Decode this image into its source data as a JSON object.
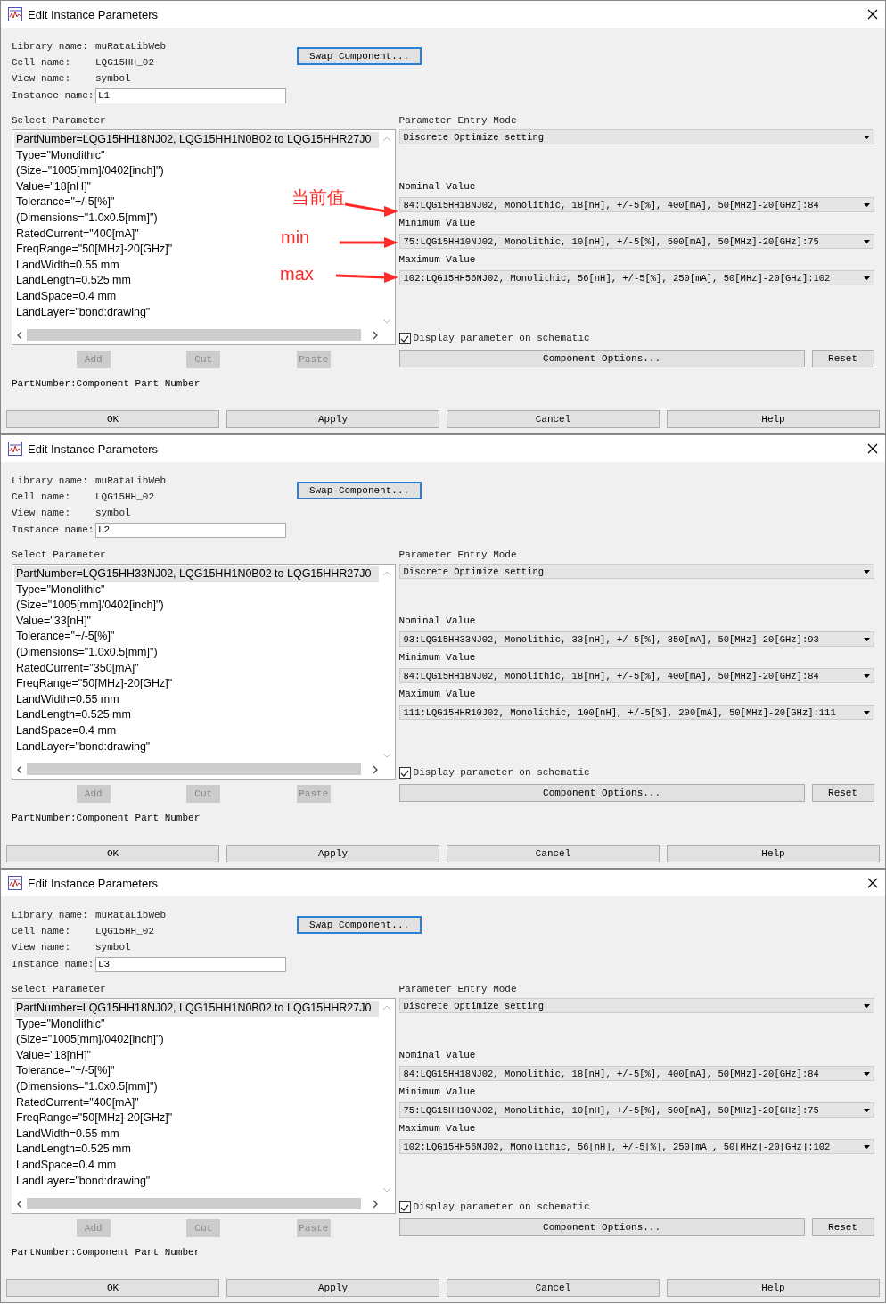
{
  "dialogs": [
    {
      "title": "Edit Instance Parameters",
      "info": [
        {
          "label": "Library name:",
          "value": "muRataLibWeb",
          "kind": "text"
        },
        {
          "label": "Cell name:",
          "value": "LQG15HH_02",
          "kind": "text"
        },
        {
          "label": "View name:",
          "value": "symbol",
          "kind": "text"
        },
        {
          "label": "Instance name:",
          "value": "L1",
          "kind": "input"
        }
      ],
      "swap_button": "Swap Component...",
      "select_parameter": {
        "label": "Select Parameter",
        "items": [
          {
            "text": "PartNumber=LQG15HH18NJ02, LQG15HH1N0B02 to LQG15HHR27J0",
            "selected": true
          },
          {
            "text": "Type=\"Monolithic\"",
            "selected": false
          },
          {
            "text": "(Size=\"1005[mm]/0402[inch]\")",
            "selected": false
          },
          {
            "text": "Value=\"18[nH]\"",
            "selected": false
          },
          {
            "text": "Tolerance=\"+/-5[%]\"",
            "selected": false
          },
          {
            "text": "(Dimensions=\"1.0x0.5[mm]\")",
            "selected": false
          },
          {
            "text": "RatedCurrent=\"400[mA]\"",
            "selected": false
          },
          {
            "text": "FreqRange=\"50[MHz]-20[GHz]\"",
            "selected": false
          },
          {
            "text": "LandWidth=0.55 mm",
            "selected": false
          },
          {
            "text": "LandLength=0.525 mm",
            "selected": false
          },
          {
            "text": "LandSpace=0.4 mm",
            "selected": false
          },
          {
            "text": "LandLayer=\"bond:drawing\"",
            "selected": false
          }
        ]
      },
      "edit_buttons": [
        {
          "label": "Add",
          "disabled": true
        },
        {
          "label": "Cut",
          "disabled": true
        },
        {
          "label": "Paste",
          "disabled": true
        }
      ],
      "description": "PartNumber:Component Part Number",
      "entry_mode": {
        "label": "Parameter Entry Mode",
        "value": "Discrete Optimize setting"
      },
      "value_fields": [
        {
          "label": "Nominal Value",
          "value": "84:LQG15HH18NJ02, Monolithic, 18[nH], +/-5[%], 400[mA], 50[MHz]-20[GHz]:84"
        },
        {
          "label": "Minimum Value",
          "value": "75:LQG15HH10NJ02, Monolithic, 10[nH], +/-5[%], 500[mA], 50[MHz]-20[GHz]:75"
        },
        {
          "label": "Maximum Value",
          "value": "102:LQG15HH56NJ02, Monolithic, 56[nH], +/-5[%], 250[mA], 50[MHz]-20[GHz]:102"
        }
      ],
      "display_checkbox": {
        "label": "Display parameter on schematic",
        "checked": true
      },
      "component_options": "Component Options...",
      "reset": "Reset",
      "footer_buttons": [
        "OK",
        "Apply",
        "Cancel",
        "Help"
      ],
      "annotations": [
        {
          "text": "当前值"
        },
        {
          "text": "min"
        },
        {
          "text": "max"
        }
      ]
    },
    {
      "title": "Edit Instance Parameters",
      "info": [
        {
          "label": "Library name:",
          "value": "muRataLibWeb",
          "kind": "text"
        },
        {
          "label": "Cell name:",
          "value": "LQG15HH_02",
          "kind": "text"
        },
        {
          "label": "View name:",
          "value": "symbol",
          "kind": "text"
        },
        {
          "label": "Instance name:",
          "value": "L2",
          "kind": "input"
        }
      ],
      "swap_button": "Swap Component...",
      "select_parameter": {
        "label": "Select Parameter",
        "items": [
          {
            "text": "PartNumber=LQG15HH33NJ02, LQG15HH1N0B02 to LQG15HHR27J0",
            "selected": true
          },
          {
            "text": "Type=\"Monolithic\"",
            "selected": false
          },
          {
            "text": "(Size=\"1005[mm]/0402[inch]\")",
            "selected": false
          },
          {
            "text": "Value=\"33[nH]\"",
            "selected": false
          },
          {
            "text": "Tolerance=\"+/-5[%]\"",
            "selected": false
          },
          {
            "text": "(Dimensions=\"1.0x0.5[mm]\")",
            "selected": false
          },
          {
            "text": "RatedCurrent=\"350[mA]\"",
            "selected": false
          },
          {
            "text": "FreqRange=\"50[MHz]-20[GHz]\"",
            "selected": false
          },
          {
            "text": "LandWidth=0.55 mm",
            "selected": false
          },
          {
            "text": "LandLength=0.525 mm",
            "selected": false
          },
          {
            "text": "LandSpace=0.4 mm",
            "selected": false
          },
          {
            "text": "LandLayer=\"bond:drawing\"",
            "selected": false
          }
        ]
      },
      "edit_buttons": [
        {
          "label": "Add",
          "disabled": true
        },
        {
          "label": "Cut",
          "disabled": true
        },
        {
          "label": "Paste",
          "disabled": true
        }
      ],
      "description": "PartNumber:Component Part Number",
      "entry_mode": {
        "label": "Parameter Entry Mode",
        "value": "Discrete Optimize setting"
      },
      "value_fields": [
        {
          "label": "Nominal Value",
          "value": "93:LQG15HH33NJ02, Monolithic, 33[nH], +/-5[%], 350[mA], 50[MHz]-20[GHz]:93"
        },
        {
          "label": "Minimum Value",
          "value": "84:LQG15HH18NJ02, Monolithic, 18[nH], +/-5[%], 400[mA], 50[MHz]-20[GHz]:84"
        },
        {
          "label": "Maximum Value",
          "value": "111:LQG15HHR10J02, Monolithic, 100[nH], +/-5[%], 200[mA], 50[MHz]-20[GHz]:111"
        }
      ],
      "display_checkbox": {
        "label": "Display parameter on schematic",
        "checked": true
      },
      "component_options": "Component Options...",
      "reset": "Reset",
      "footer_buttons": [
        "OK",
        "Apply",
        "Cancel",
        "Help"
      ]
    },
    {
      "title": "Edit Instance Parameters",
      "info": [
        {
          "label": "Library name:",
          "value": "muRataLibWeb",
          "kind": "text"
        },
        {
          "label": "Cell name:",
          "value": "LQG15HH_02",
          "kind": "text"
        },
        {
          "label": "View name:",
          "value": "symbol",
          "kind": "text"
        },
        {
          "label": "Instance name:",
          "value": "L3",
          "kind": "input"
        }
      ],
      "swap_button": "Swap Component...",
      "select_parameter": {
        "label": "Select Parameter",
        "items": [
          {
            "text": "PartNumber=LQG15HH18NJ02, LQG15HH1N0B02 to LQG15HHR27J0",
            "selected": true
          },
          {
            "text": "Type=\"Monolithic\"",
            "selected": false
          },
          {
            "text": "(Size=\"1005[mm]/0402[inch]\")",
            "selected": false
          },
          {
            "text": "Value=\"18[nH]\"",
            "selected": false
          },
          {
            "text": "Tolerance=\"+/-5[%]\"",
            "selected": false
          },
          {
            "text": "(Dimensions=\"1.0x0.5[mm]\")",
            "selected": false
          },
          {
            "text": "RatedCurrent=\"400[mA]\"",
            "selected": false
          },
          {
            "text": "FreqRange=\"50[MHz]-20[GHz]\"",
            "selected": false
          },
          {
            "text": "LandWidth=0.55 mm",
            "selected": false
          },
          {
            "text": "LandLength=0.525 mm",
            "selected": false
          },
          {
            "text": "LandSpace=0.4 mm",
            "selected": false
          },
          {
            "text": "LandLayer=\"bond:drawing\"",
            "selected": false
          }
        ]
      },
      "edit_buttons": [
        {
          "label": "Add",
          "disabled": true
        },
        {
          "label": "Cut",
          "disabled": true
        },
        {
          "label": "Paste",
          "disabled": true
        }
      ],
      "description": "PartNumber:Component Part Number",
      "entry_mode": {
        "label": "Parameter Entry Mode",
        "value": "Discrete Optimize setting"
      },
      "value_fields": [
        {
          "label": "Nominal Value",
          "value": "84:LQG15HH18NJ02, Monolithic, 18[nH], +/-5[%], 400[mA], 50[MHz]-20[GHz]:84"
        },
        {
          "label": "Minimum Value",
          "value": "75:LQG15HH10NJ02, Monolithic, 10[nH], +/-5[%], 500[mA], 50[MHz]-20[GHz]:75"
        },
        {
          "label": "Maximum Value",
          "value": "102:LQG15HH56NJ02, Monolithic, 56[nH], +/-5[%], 250[mA], 50[MHz]-20[GHz]:102"
        }
      ],
      "display_checkbox": {
        "label": "Display parameter on schematic",
        "checked": true
      },
      "component_options": "Component Options...",
      "reset": "Reset",
      "footer_buttons": [
        "OK",
        "Apply",
        "Cancel",
        "Help"
      ]
    }
  ]
}
